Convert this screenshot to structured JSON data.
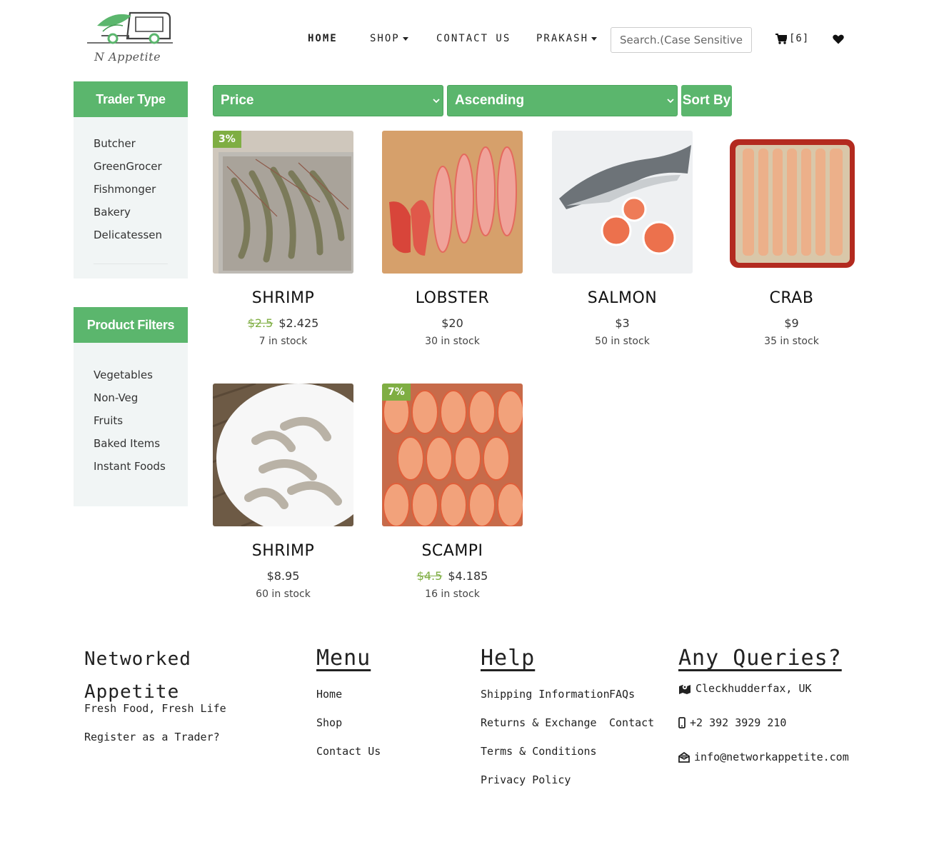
{
  "header": {
    "logo_text": "N Appetite",
    "nav": [
      {
        "label": "HOME"
      },
      {
        "label": "SHOP"
      },
      {
        "label": "CONTACT US"
      },
      {
        "label": "PRAKASH"
      }
    ],
    "search_placeholder": "Search.(Case Sensitive)",
    "cart_count": "[6]"
  },
  "sidebar": {
    "trader_type": {
      "title": "Trader Type",
      "items": [
        "Butcher",
        "GreenGrocer",
        "Fishmonger",
        "Bakery",
        "Delicatessen"
      ]
    },
    "product_filters": {
      "title": "Product Filters",
      "items": [
        "Vegetables",
        "Non-Veg",
        "Fruits",
        "Baked Items",
        "Instant Foods"
      ]
    }
  },
  "filters": {
    "sort_field": "Price",
    "sort_order": "Ascending",
    "sort_button": "Sort By"
  },
  "products": [
    {
      "name": "SHRIMP",
      "old_price": "$2.5",
      "price": "$2.425",
      "stock": "7 in stock",
      "badge": "3%"
    },
    {
      "name": "LOBSTER",
      "old_price": "",
      "price": "$20",
      "stock": "30 in stock",
      "badge": ""
    },
    {
      "name": "SALMON",
      "old_price": "",
      "price": "$3",
      "stock": "50 in stock",
      "badge": ""
    },
    {
      "name": "CRAB",
      "old_price": "",
      "price": "$9",
      "stock": "35 in stock",
      "badge": ""
    },
    {
      "name": "SHRIMP",
      "old_price": "",
      "price": "$8.95",
      "stock": "60 in stock",
      "badge": ""
    },
    {
      "name": "SCAMPI",
      "old_price": "$4.5",
      "price": "$4.185",
      "stock": "16 in stock",
      "badge": "7%"
    }
  ],
  "footer": {
    "brand_line1": "Networked",
    "brand_line2": "Appetite",
    "tagline": "Fresh Food, Fresh Life",
    "register": "Register as a Trader?",
    "menu": {
      "title": "Menu",
      "items": [
        "Home",
        "Shop",
        "Contact Us"
      ]
    },
    "help": {
      "title": "Help",
      "items": [
        "Shipping Information",
        "Returns & Exchange",
        "Terms & Conditions",
        "Privacy Policy"
      ],
      "items2": [
        "FAQs",
        "Contact"
      ]
    },
    "queries": {
      "title": "Any Queries?",
      "address": "Cleckhudderfax, UK",
      "phone": "+2 392 3929 210",
      "email": "info@networkappetite.com"
    }
  },
  "colors": {
    "accent": "#5bb66d",
    "badge": "#7fae43",
    "sidebar_bg": "#f1f5f5"
  }
}
